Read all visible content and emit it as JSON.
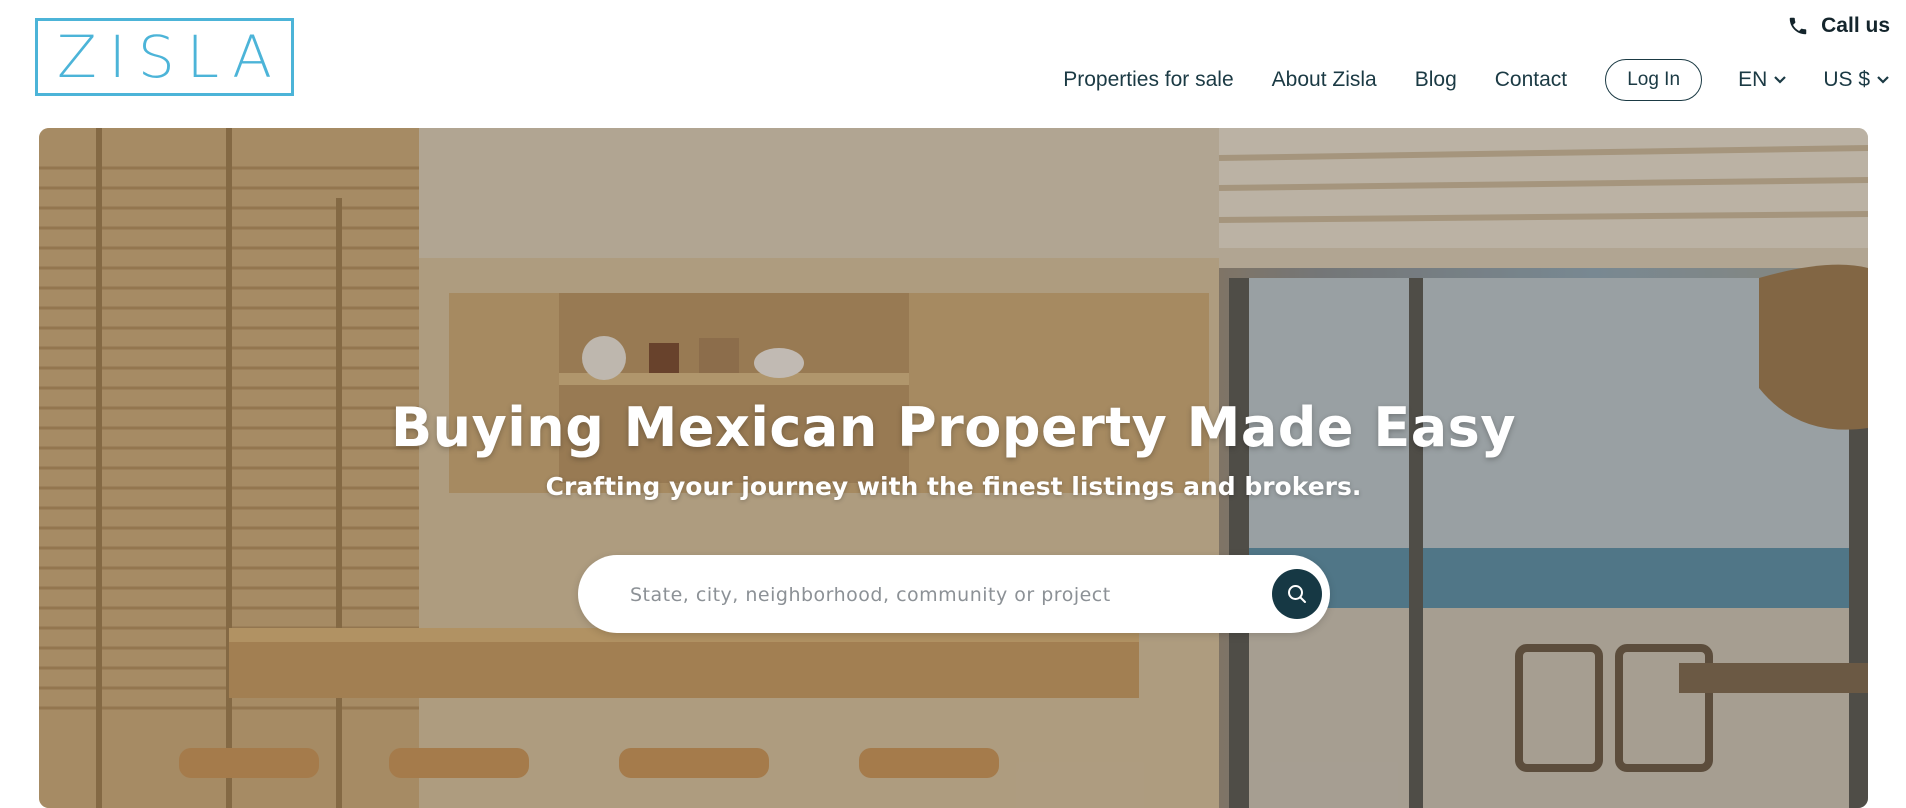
{
  "brand": {
    "logo_text": "ZISLA",
    "color": "#4cb4d8"
  },
  "header": {
    "call_label": "Call us",
    "nav": [
      {
        "label": "Properties for sale"
      },
      {
        "label": "About Zisla"
      },
      {
        "label": "Blog"
      },
      {
        "label": "Contact"
      }
    ],
    "login_label": "Log In",
    "language": "EN",
    "currency": "US $"
  },
  "hero": {
    "title": "Buying Mexican Property Made Easy",
    "subtitle": "Crafting your journey with the finest listings and brokers.",
    "search": {
      "placeholder": "State, city, neighborhood, community or project",
      "value": ""
    },
    "search_button_color": "#163844"
  },
  "icons": {
    "phone": "phone-icon",
    "chevron": "chevron-down-icon",
    "search": "search-icon"
  }
}
